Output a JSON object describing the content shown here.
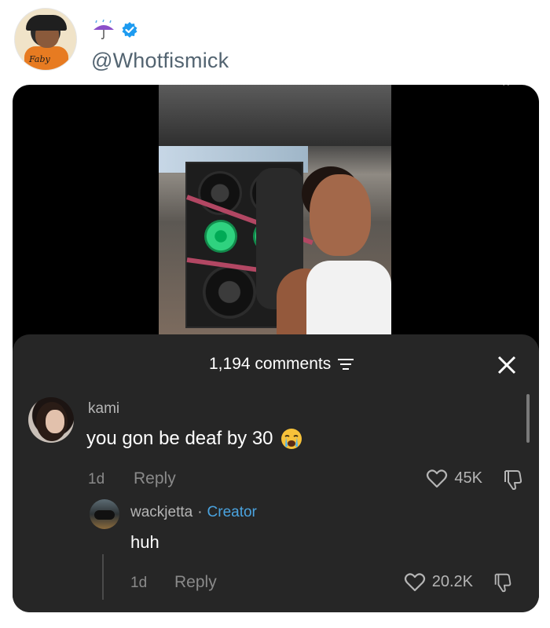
{
  "tweet": {
    "handle": "@Whotfismick",
    "avatar_jersey_text": "Faby",
    "name_icons": [
      "umbrella-with-rain-icon",
      "verified-badge-icon"
    ],
    "verified_color": "#1d9bf0"
  },
  "comments_sheet": {
    "title": "1,194 comments",
    "filter_icon": "filter-icon",
    "close_icon": "close-icon"
  },
  "comment": {
    "username": "kami",
    "text": "you gon be deaf by 30",
    "emoji": "crying-face-icon",
    "time": "1d",
    "reply_label": "Reply",
    "likes": "45K"
  },
  "reply": {
    "username": "wackjetta",
    "separator": "·",
    "badge": "Creator",
    "badge_color": "#4aa3df",
    "text": "huh",
    "time": "1d",
    "reply_label": "Reply",
    "likes": "20.2K"
  }
}
